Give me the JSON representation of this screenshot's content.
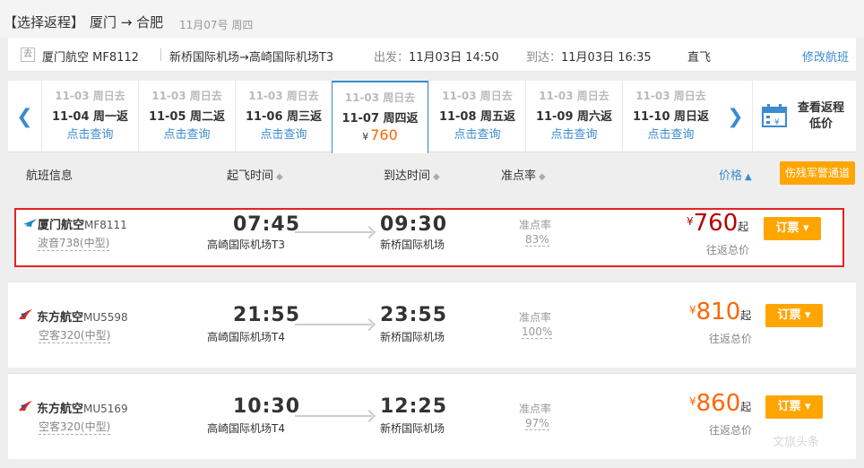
{
  "header": {
    "title_prefix": "【选择返程】",
    "route": "厦门 → 合肥",
    "date": "11月07号 周四"
  },
  "info": {
    "tag": "去",
    "flight": "厦门航空 MF8112",
    "route": "新桥国际机场→高崎国际机场T3",
    "depart_label": "出发：",
    "depart": "11月03日 14:50",
    "arrive_label": "到达：",
    "arrive": "11月03日 16:35",
    "type": "直飞",
    "modify": "修改航班"
  },
  "date_strip": {
    "dates": [
      {
        "go": "11-03 周日去",
        "ret": "11-04 周一返",
        "action": "点击查询"
      },
      {
        "go": "11-03 周日去",
        "ret": "11-05 周二返",
        "action": "点击查询"
      },
      {
        "go": "11-03 周日去",
        "ret": "11-06 周三返",
        "action": "点击查询"
      },
      {
        "go": "11-03 周日去",
        "ret": "11-07 周四返",
        "yen": "¥",
        "price": "760"
      },
      {
        "go": "11-03 周日去",
        "ret": "11-08 周五返",
        "action": "点击查询"
      },
      {
        "go": "11-03 周日去",
        "ret": "11-09 周六返",
        "action": "点击查询"
      },
      {
        "go": "11-03 周日去",
        "ret": "11-10 周日返",
        "action": "点击查询"
      }
    ],
    "return_low_line1": "查看返程",
    "return_low_line2": "低价"
  },
  "columns": {
    "flight_info": "航班信息",
    "depart_time": "起飞时间",
    "arrive_time": "到达时间",
    "ontime": "准点率",
    "price": "价格",
    "military": "伤残军警通道"
  },
  "flights": [
    {
      "airline": "厦门航空",
      "no": "MF8111",
      "plane": "波音738(中型)",
      "dep_time": "07:45",
      "dep_apt": "高崎国际机场T3",
      "arr_time": "09:30",
      "arr_apt": "新桥国际机场",
      "ontime_label": "准点率",
      "ontime": "83%",
      "yen": "¥",
      "price": "760",
      "qi": "起",
      "roundtrip": "往返总价",
      "book": "订票 ▾",
      "logo_color": "#1e88c8"
    },
    {
      "airline": "东方航空",
      "no": "MU5598",
      "plane": "空客320(中型)",
      "dep_time": "21:55",
      "dep_apt": "高崎国际机场T4",
      "arr_time": "23:55",
      "arr_apt": "新桥国际机场",
      "ontime_label": "准点率",
      "ontime": "100%",
      "yen": "¥",
      "price": "810",
      "qi": "起",
      "roundtrip": "往返总价",
      "book": "订票 ▾",
      "logo_color": "#d42a2a"
    },
    {
      "airline": "东方航空",
      "no": "MU5169",
      "plane": "空客320(中型)",
      "dep_time": "10:30",
      "dep_apt": "高崎国际机场T4",
      "arr_time": "12:25",
      "arr_apt": "新桥国际机场",
      "ontime_label": "准点率",
      "ontime": "97%",
      "yen": "¥",
      "price": "860",
      "qi": "起",
      "roundtrip": "往返总价",
      "book": "订票 ▾",
      "logo_color": "#d42a2a"
    }
  ],
  "watermark": "文旅头条"
}
